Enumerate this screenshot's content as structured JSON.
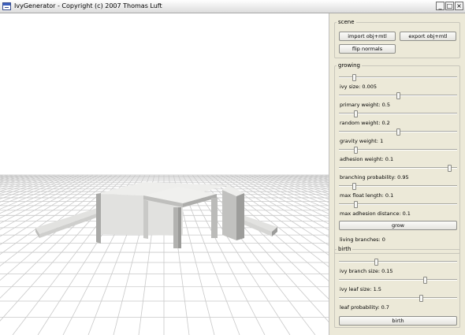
{
  "window": {
    "title": "IvyGenerator  - Copyright (c) 2007 Thomas Luft",
    "minimize_glyph": "_",
    "maximize_glyph": "□",
    "close_glyph": "×"
  },
  "scene": {
    "legend": "scene",
    "import_label": "import obj+mtl",
    "export_label": "export obj+mtl",
    "flip_label": "flip normals"
  },
  "growing": {
    "legend": "growing",
    "sliders": [
      {
        "label": "",
        "level": 0.12
      },
      {
        "label": "ivy size: 0.005",
        "level": 0.5
      },
      {
        "label": "primary weight: 0.5",
        "level": 0.13
      },
      {
        "label": "random weight: 0.2",
        "level": 0.5
      },
      {
        "label": "gravity weight: 1",
        "level": 0.13
      },
      {
        "label": "adhesion weight: 0.1",
        "level": 0.95
      },
      {
        "label": "branching probability: 0.95",
        "level": 0.12
      },
      {
        "label": "max float length: 0.1",
        "level": 0.13
      },
      {
        "label": "max adhesion distance: 0.1",
        "level": null
      }
    ],
    "grow_label": "grow",
    "living_branches": "living branches: 0"
  },
  "birth": {
    "legend": "birth",
    "sliders": [
      {
        "label": "",
        "level": 0.31
      },
      {
        "label": "ivy branch size: 0.15",
        "level": 0.74
      },
      {
        "label": "ivy leaf size: 1.5",
        "level": 0.7
      },
      {
        "label": "leaf probability: 0.7",
        "level": null
      }
    ],
    "birth_label": "birth"
  },
  "colors": {
    "window_bg": "#ece9d8",
    "viewport_bg": "#ffffff",
    "grid": "#c9c9c9",
    "model_light": "#e6e6e6",
    "model_mid": "#c3c3c3",
    "model_dark": "#9a9a9a"
  },
  "icons": [
    "app-icon",
    "minimize-icon",
    "maximize-icon",
    "close-icon"
  ]
}
